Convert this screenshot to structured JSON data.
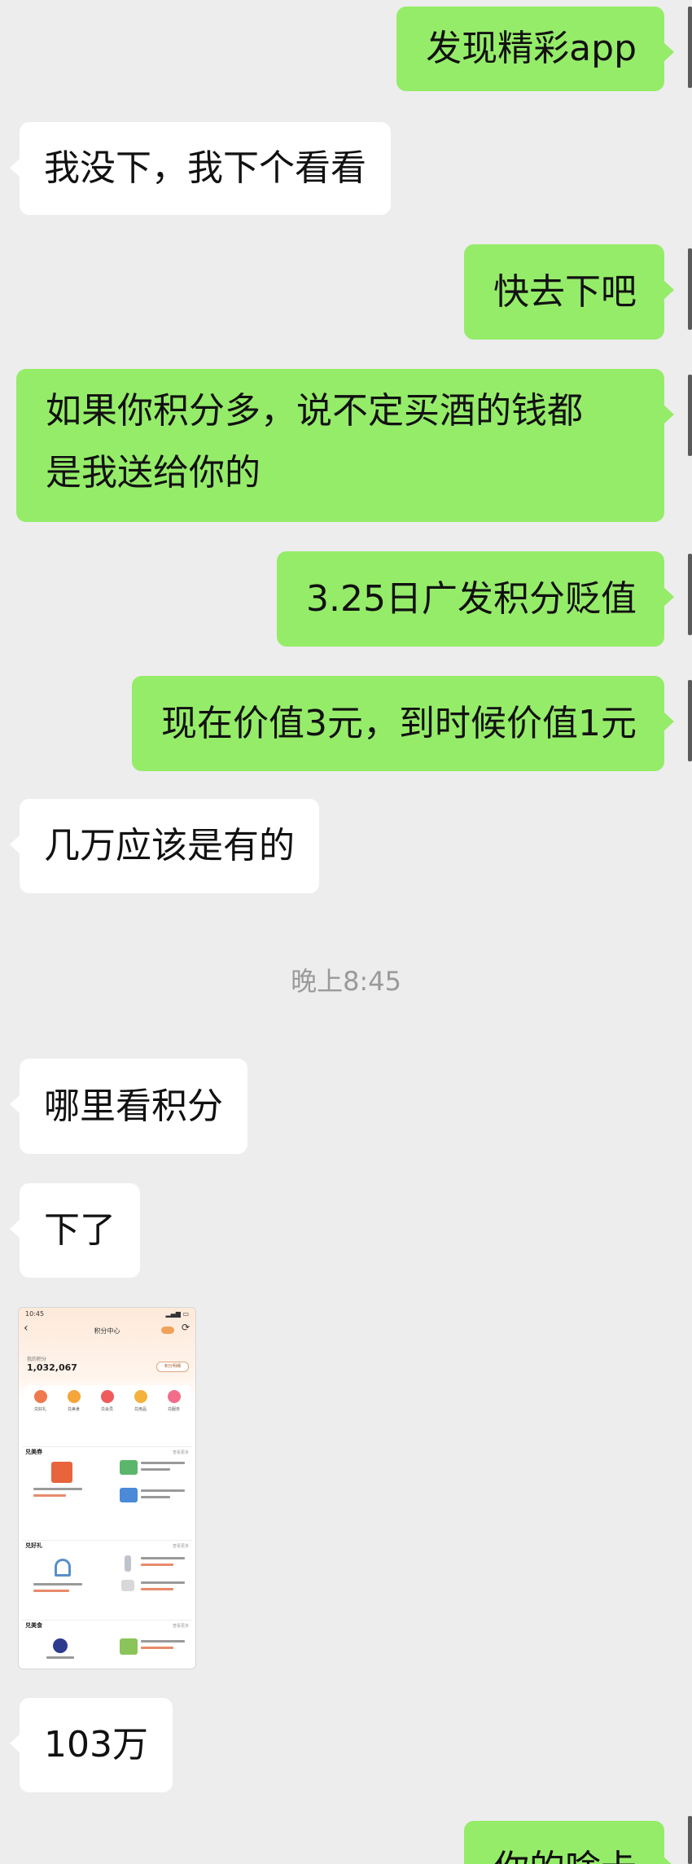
{
  "messages": [
    {
      "side": "out",
      "text": "发现精彩app"
    },
    {
      "side": "in",
      "text": "我没下，我下个看看"
    },
    {
      "side": "out",
      "text": "快去下吧"
    },
    {
      "side": "out",
      "lines": [
        "如果你积分多，说不定买酒的钱都",
        "是我送给你的"
      ]
    },
    {
      "side": "out",
      "text": "3.25日广发积分贬值"
    },
    {
      "side": "out",
      "text": "现在价值3元，到时候价值1元"
    },
    {
      "side": "in",
      "text": "几万应该是有的"
    },
    {
      "side": "in",
      "text": "哪里看积分"
    },
    {
      "side": "in",
      "text": "下了"
    },
    {
      "side": "in",
      "text": "103万"
    },
    {
      "side": "out",
      "text": "你的啥卡"
    }
  ],
  "timestamp": "晚上8:45",
  "screenshot_thumb": {
    "status_time": "10:45",
    "title": "积分中心",
    "points_label": "我的积分",
    "points": "1,032,067",
    "detail_button": "积分明细",
    "categories": [
      "兑好礼",
      "兑美食",
      "兑会员",
      "兑用品",
      "兑服务"
    ],
    "sections": [
      {
        "title": "兑美券",
        "more": "查看更多"
      },
      {
        "title": "兑好礼",
        "more": "查看更多"
      },
      {
        "title": "兑美食",
        "more": "查看更多"
      }
    ],
    "colors": {
      "header": "#fde9d9",
      "accent": "#e8643c"
    }
  },
  "colors": {
    "background": "#ededed",
    "incoming": "#ffffff",
    "outgoing": "#95ec69",
    "timestamp": "#9a9a9a"
  }
}
